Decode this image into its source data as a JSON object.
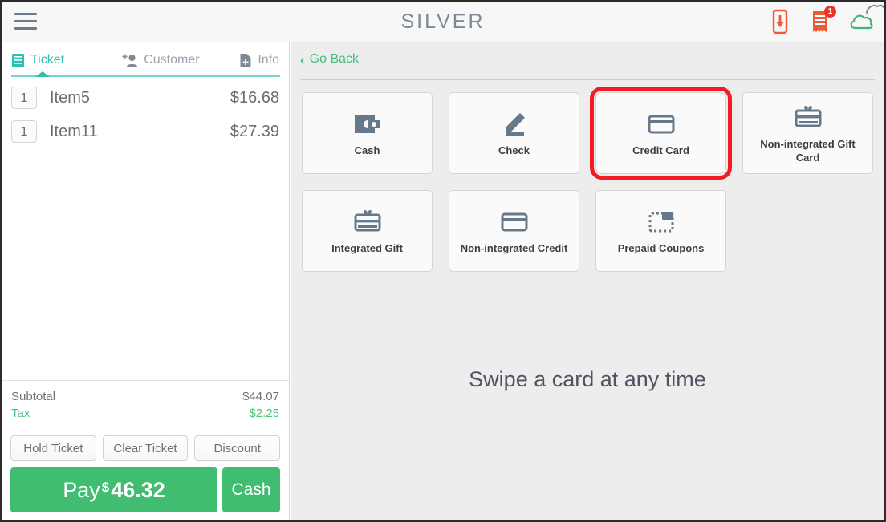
{
  "app": {
    "brand": "SILVER",
    "menu_icon": "hamburger-menu-icon",
    "accent_green": "#41bd72",
    "accent_teal": "#2fbfb0",
    "highlight_red": "#f21c24"
  },
  "topbar": {
    "icons": [
      {
        "name": "download-to-device-icon",
        "color": "#ef5a34"
      },
      {
        "name": "receipt-icon",
        "color": "#ef5a34",
        "badge": "1"
      },
      {
        "name": "cloud-icon",
        "color": "#3cb878"
      }
    ]
  },
  "left_panel": {
    "tabs": [
      {
        "label": "Ticket",
        "icon": "ticket-icon",
        "active": true
      },
      {
        "label": "Customer",
        "icon": "add-customer-icon",
        "active": false
      },
      {
        "label": "Info",
        "icon": "info-document-icon",
        "active": false
      }
    ],
    "items": [
      {
        "qty": "1",
        "name": "Item5",
        "price": "$16.68"
      },
      {
        "qty": "1",
        "name": "Item11",
        "price": "$27.39"
      }
    ],
    "totals": [
      {
        "label": "Subtotal",
        "value": "$44.07"
      },
      {
        "label": "Tax",
        "value": "$2.25"
      }
    ],
    "actions": [
      {
        "label": "Hold Ticket"
      },
      {
        "label": "Clear Ticket"
      },
      {
        "label": "Discount"
      }
    ],
    "pay": {
      "label": "Pay",
      "dollar": "$",
      "amount": "46.32",
      "cash_label": "Cash"
    }
  },
  "right_panel": {
    "go_back": "Go Back",
    "go_back_chevron": "‹",
    "tiles_row1": [
      {
        "label": "Cash",
        "icon": "wallet-icon",
        "highlighted": false
      },
      {
        "label": "Check",
        "icon": "pencil-signature-icon",
        "highlighted": false
      },
      {
        "label": "Credit Card",
        "icon": "credit-card-icon",
        "highlighted": true
      },
      {
        "label": "Non-integrated Gift Card",
        "icon": "gift-card-icon",
        "highlighted": false
      }
    ],
    "tiles_row2": [
      {
        "label": "Integrated Gift",
        "icon": "gift-card-icon",
        "highlighted": false
      },
      {
        "label": "Non-integrated Credit",
        "icon": "credit-card-icon",
        "highlighted": false
      },
      {
        "label": "Prepaid Coupons",
        "icon": "coupon-icon",
        "highlighted": false
      }
    ],
    "swipe_message": "Swipe a card at any time"
  }
}
